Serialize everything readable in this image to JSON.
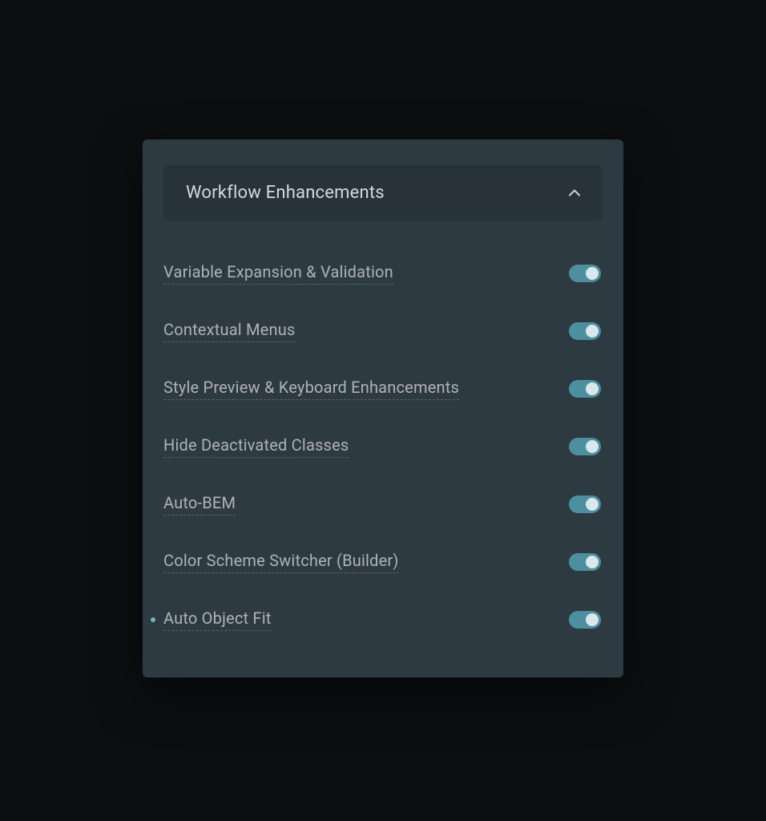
{
  "section": {
    "title": "Workflow Enhancements",
    "expanded": true
  },
  "options": [
    {
      "label": "Variable Expansion & Validation",
      "on": true,
      "bullet": false
    },
    {
      "label": "Contextual Menus",
      "on": true,
      "bullet": false
    },
    {
      "label": "Style Preview & Keyboard Enhancements",
      "on": true,
      "bullet": false
    },
    {
      "label": "Hide Deactivated Classes",
      "on": true,
      "bullet": false
    },
    {
      "label": "Auto-BEM",
      "on": true,
      "bullet": false
    },
    {
      "label": "Color Scheme Switcher (Builder)",
      "on": true,
      "bullet": false
    },
    {
      "label": "Auto Object Fit",
      "on": true,
      "bullet": true
    }
  ],
  "colors": {
    "bg": "#0d0e10",
    "panel": "#2e3a42",
    "header": "#27323a",
    "text": "#d6d8da",
    "labelText": "#aeb2b5",
    "toggleOn": "#4d8fa0",
    "toggleKnob": "#d9e8ec",
    "bullet": "#6eb7c7"
  }
}
